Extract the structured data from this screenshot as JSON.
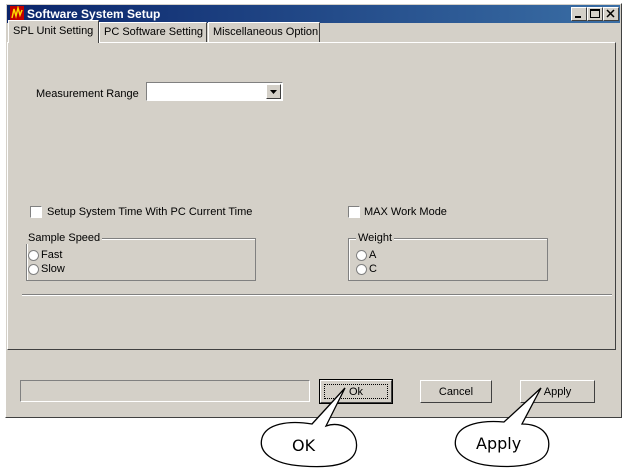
{
  "window": {
    "title": "Software System Setup"
  },
  "tabs": [
    {
      "label": "SPL Unit Setting",
      "active": true
    },
    {
      "label": "PC Software Setting",
      "active": false
    },
    {
      "label": "Miscellaneous Option",
      "active": false
    }
  ],
  "spl_unit": {
    "measurement_range_label": "Measurement Range",
    "measurement_range_value": "",
    "setup_time_label": "Setup System Time With PC Current Time",
    "max_mode_label": "MAX Work Mode",
    "sample_speed": {
      "title": "Sample Speed",
      "options": [
        "Fast",
        "Slow"
      ]
    },
    "weight": {
      "title": "Weight",
      "options": [
        "A",
        "C"
      ]
    }
  },
  "footer": {
    "status_text": "",
    "ok_label": "Ok",
    "cancel_label": "Cancel",
    "apply_label": "Apply"
  },
  "callouts": {
    "ok": "OK",
    "apply": "Apply"
  }
}
